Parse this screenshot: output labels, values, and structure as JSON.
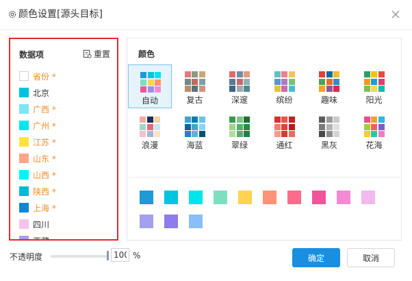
{
  "dialog": {
    "title": "颜色设置[源头目标]",
    "title_icon": "gear-icon",
    "close_icon": "close-icon"
  },
  "data_items": {
    "header": "数据项",
    "reset_label": "重置",
    "reset_icon": "reset-icon",
    "items": [
      {
        "label": "省份 *",
        "color": "#ffffff",
        "highlight": true
      },
      {
        "label": "北京",
        "color": "#00c1e0",
        "highlight": false
      },
      {
        "label": "广西 *",
        "color": "#7ce6f3",
        "highlight": true
      },
      {
        "label": "广州 *",
        "color": "#00e7ee",
        "highlight": true
      },
      {
        "label": "江苏 *",
        "color": "#ffe43c",
        "highlight": true
      },
      {
        "label": "山东 *",
        "color": "#ffa58a",
        "highlight": true
      },
      {
        "label": "山西 *",
        "color": "#00f4fb",
        "highlight": true
      },
      {
        "label": "陕西 *",
        "color": "#00b9d7",
        "highlight": true
      },
      {
        "label": "上海 *",
        "color": "#0b86d8",
        "highlight": true
      },
      {
        "label": "四川",
        "color": "#f2c3ef",
        "highlight": false
      },
      {
        "label": "西藏",
        "color": "#a59ff0",
        "highlight": false
      }
    ]
  },
  "schemes": {
    "header": "颜色",
    "selected": "自动",
    "items": [
      {
        "name": "自动",
        "colors": [
          "#1e9ad6",
          "#00c5e0",
          "#00e4ec",
          "#7edfc0",
          "#ffd451",
          "#ff9374",
          "#f2549c",
          "#9f8cef",
          "#f38bd4"
        ]
      },
      {
        "name": "复古",
        "colors": [
          "#e37a7a",
          "#8a9a85",
          "#c9a877",
          "#6d8b89",
          "#c26b5c",
          "#7b9fa6",
          "#b78d6b",
          "#5b7374",
          "#d5917f"
        ]
      },
      {
        "name": "深邃",
        "colors": [
          "#dc6d73",
          "#6f8ea3",
          "#e39a84",
          "#5a7a95",
          "#c76a6f",
          "#8db4b5",
          "#3e6784",
          "#a4a7ad",
          "#4b8a90"
        ]
      },
      {
        "name": "缤纷",
        "colors": [
          "#62c1bd",
          "#e8838d",
          "#f6c35c",
          "#5895d1",
          "#a57ec4",
          "#6cc57a",
          "#e6c13a",
          "#c96bb1",
          "#52b9d0"
        ]
      },
      {
        "name": "趣味",
        "colors": [
          "#e73e39",
          "#0f6d9e",
          "#f0bb2a",
          "#4aa64e",
          "#e8701f",
          "#2d8ccb",
          "#f5a12e",
          "#8f54a4",
          "#d52c4a"
        ]
      },
      {
        "name": "阳光",
        "colors": [
          "#2e9f62",
          "#f7c300",
          "#e84a3c",
          "#f39b1c",
          "#18a1cf",
          "#e33c70",
          "#7cc14e",
          "#f6d84d",
          "#0dbfa8"
        ]
      },
      {
        "name": "浪漫",
        "colors": [
          "#f3a9a6",
          "#1e2f58",
          "#f6d0a8",
          "#a1d7c9",
          "#e4697a",
          "#cbe7f1",
          "#f4c1cf",
          "#9fb6d8",
          "#fce3c4"
        ]
      },
      {
        "name": "海蓝",
        "colors": [
          "#3fa2d8",
          "#0f7ab1",
          "#67c4e9",
          "#1e5f8f",
          "#40a9c2",
          "#8bd5ef",
          "#2784b9",
          "#5db4d6",
          "#0b4f73"
        ]
      },
      {
        "name": "翠绿",
        "colors": [
          "#3a9c4e",
          "#7cc58b",
          "#1f6e36",
          "#9fd18f",
          "#4fb36a",
          "#2a8a45",
          "#b6dc9b",
          "#5fa870",
          "#207f48"
        ]
      },
      {
        "name": "通红",
        "colors": [
          "#d7312a",
          "#ee5546",
          "#c2231f",
          "#f47c6a",
          "#e04139",
          "#b81b18",
          "#f29b8a",
          "#d83a32",
          "#ea6b5b"
        ]
      },
      {
        "name": "黑灰",
        "colors": [
          "#5c5c5c",
          "#9b9b9b",
          "#c9c9c9",
          "#7a7a7a",
          "#b3b3b3",
          "#e0e0e0",
          "#4a4a4a",
          "#8e8e8e",
          "#d4d4d4"
        ]
      },
      {
        "name": "花海",
        "colors": [
          "#e8508d",
          "#f6a12f",
          "#36b3e6",
          "#9cd13b",
          "#f45c5e",
          "#7e5ec2",
          "#f8cc2a",
          "#2ec5a6",
          "#f07ec2"
        ]
      }
    ]
  },
  "palette": [
    "#1e9ad6",
    "#00c5e0",
    "#00e4ec",
    "#7edfc0",
    "#ffd451",
    "#ff9374",
    "#fe6b8b",
    "#f2549c",
    "#f38bd4",
    "#f2b9ef",
    "#a59ff0",
    "#8c7ced",
    "#89befa"
  ],
  "opacity": {
    "label": "不透明度",
    "value": "100",
    "unit": "%",
    "level_percent": 100
  },
  "buttons": {
    "ok": "确定",
    "cancel": "取消"
  },
  "colors": {
    "accent": "#1a8fe0",
    "highlight_text": "#f08c2c",
    "annotation_border": "#e0292b"
  }
}
